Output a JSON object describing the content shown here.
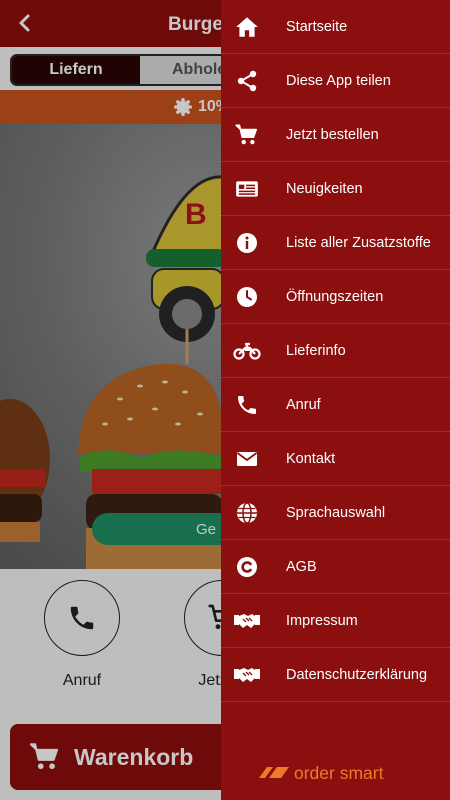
{
  "app": {
    "title": "Burgers",
    "toggle": {
      "deliver": "Liefern",
      "pickup": "Abholen"
    },
    "promo": "10%",
    "order_button": "Ge",
    "quick_actions": [
      {
        "label": "Anruf",
        "icon": "phone-icon"
      },
      {
        "label": "Jetzt b",
        "icon": "cart-icon"
      }
    ],
    "cart_button": "Warenkorb",
    "colors": {
      "primary": "#8e0e0e",
      "promo": "#c8521e",
      "order": "#1f8f63"
    }
  },
  "drawer": {
    "items": [
      {
        "label": "Startseite",
        "icon": "home-icon"
      },
      {
        "label": "Diese App teilen",
        "icon": "share-icon"
      },
      {
        "label": "Jetzt bestellen",
        "icon": "cart-icon"
      },
      {
        "label": "Neuigkeiten",
        "icon": "news-icon"
      },
      {
        "label": "Liste aller Zusatzstoffe",
        "icon": "info-icon"
      },
      {
        "label": "Öffnungszeiten",
        "icon": "clock-icon"
      },
      {
        "label": "Lieferinfo",
        "icon": "motorcycle-icon"
      },
      {
        "label": "Anruf",
        "icon": "phone-icon"
      },
      {
        "label": "Kontakt",
        "icon": "mail-icon"
      },
      {
        "label": "Sprachauswahl",
        "icon": "globe-icon"
      },
      {
        "label": "AGB",
        "icon": "copyright-icon"
      },
      {
        "label": "Impressum",
        "icon": "handshake-icon"
      },
      {
        "label": "Datenschutzerklärung",
        "icon": "handshake-icon"
      }
    ],
    "brand": "order smart",
    "colors": {
      "background": "#8c0f0f",
      "brand": "#f07a2a"
    }
  }
}
